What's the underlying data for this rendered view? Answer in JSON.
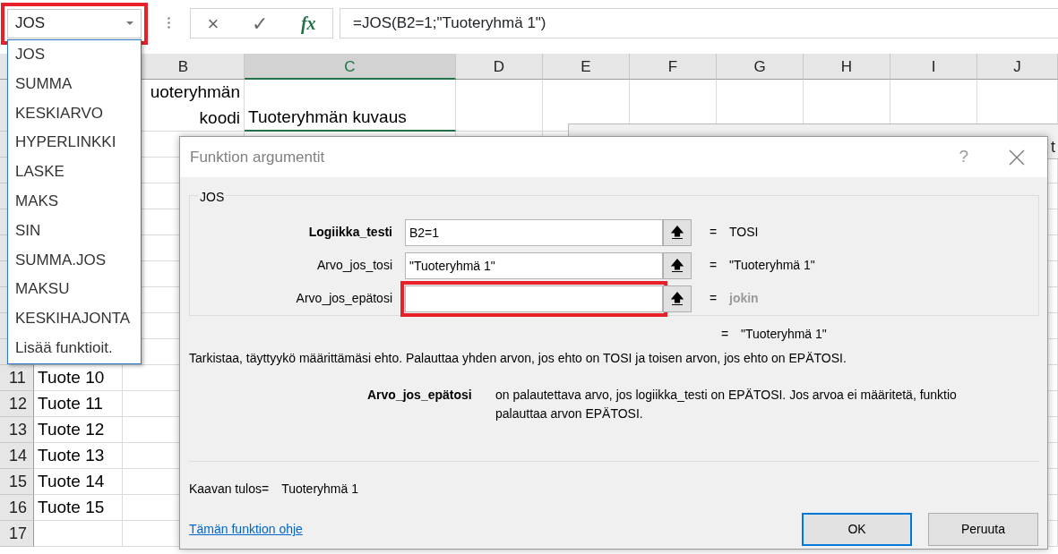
{
  "name_box": {
    "value": "JOS",
    "highlighted": true
  },
  "function_list": {
    "items": [
      "JOS",
      "SUMMA",
      "KESKIARVO",
      "HYPERLINKKI",
      "LASKE",
      "MAKS",
      "SIN",
      "SUMMA.JOS",
      "MAKSU",
      "KESKIHAJONTA",
      "Lisää funktioit."
    ]
  },
  "formula_bar": {
    "cancel": "×",
    "enter": "✓",
    "function": "fx",
    "formula": "=JOS(B2=1;\"Tuoteryhmä 1\")"
  },
  "sheet": {
    "columns": [
      {
        "label": "B",
        "selected": false
      },
      {
        "label": "C",
        "selected": true
      },
      {
        "label": "D",
        "selected": false
      },
      {
        "label": "E",
        "selected": false
      },
      {
        "label": "F",
        "selected": false
      },
      {
        "label": "G",
        "selected": false
      },
      {
        "label": "H",
        "selected": false
      },
      {
        "label": "I",
        "selected": false
      },
      {
        "label": "J",
        "selected": false
      }
    ],
    "rows": [
      {
        "cells": {
          "B": "uoteryhmän koodi",
          "C": "Tuoteryhmän kuvaus"
        }
      },
      {},
      {},
      {},
      {},
      {},
      {},
      {},
      {},
      {},
      {
        "number": "11",
        "cells": {
          "A": "Tuote 10"
        }
      },
      {
        "number": "12",
        "cells": {
          "A": "Tuote 11"
        }
      },
      {
        "number": "13",
        "cells": {
          "A": "Tuote 12"
        }
      },
      {
        "number": "14",
        "cells": {
          "A": "Tuote 13"
        }
      },
      {
        "number": "15",
        "cells": {
          "A": "Tuote 14"
        }
      },
      {
        "number": "16",
        "cells": {
          "A": "Tuote 15"
        }
      },
      {
        "number": "17"
      }
    ]
  },
  "background_window": {
    "text_fragment": "t"
  },
  "dialog": {
    "title": "Funktion argumentit",
    "help": "?",
    "group": "JOS",
    "arguments": [
      {
        "label": "Logiikka_testi",
        "value": "B2=1",
        "equals": "=",
        "result": "TOSI",
        "required": true,
        "result_known": true,
        "highlighted": false
      },
      {
        "label": "Arvo_jos_tosi",
        "value": "\"Tuoteryhmä 1\"",
        "equals": "=",
        "result": "\"Tuoteryhmä 1\"",
        "required": false,
        "result_known": true,
        "highlighted": false
      },
      {
        "label": "Arvo_jos_epätosi",
        "equals": "=",
        "result": "jokin",
        "required": false,
        "result_known": false,
        "highlighted": true
      }
    ],
    "overall_equals": "=",
    "overall_result": "\"Tuoteryhmä 1\"",
    "description": "Tarkistaa, täyttyykö määrittämäsi ehto. Palauttaa yhden arvon, jos ehto on TOSI ja toisen arvon, jos ehto on EPÄTOSI.",
    "argument_help": {
      "name": "Arvo_jos_epätosi",
      "text": "on palautettava arvo, jos logiikka_testi on EPÄTOSI. Jos arvoa ei määritetä, funktio palauttaa arvon EPÄTOSI."
    },
    "formula_result": {
      "label": "Kaavan tulos=",
      "value": "Tuoteryhmä 1"
    },
    "help_link": "Tämän funktion ohje",
    "buttons": [
      {
        "label": "OK",
        "default": true
      },
      {
        "label": "Peruuta",
        "default": false
      }
    ]
  }
}
